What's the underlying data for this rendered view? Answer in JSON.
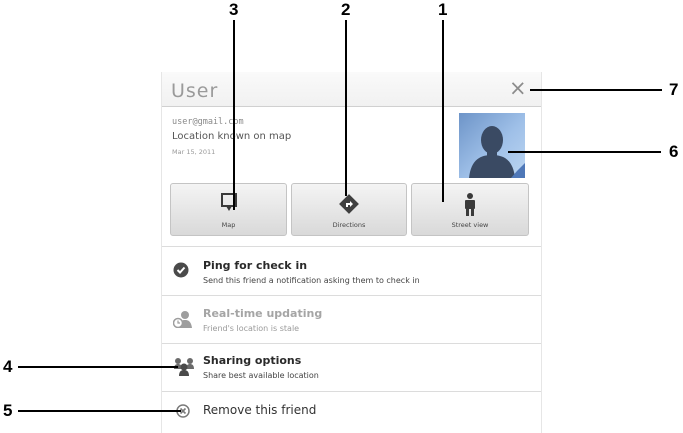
{
  "callouts": [
    "1",
    "2",
    "3",
    "4",
    "5",
    "6",
    "7"
  ],
  "dialog": {
    "title": "User",
    "close_glyph": "×"
  },
  "profile": {
    "email": "user@gmail.com",
    "location_status": "Location known on map",
    "date": "Mar 15, 2011",
    "avatar_icon": "person-silhouette-icon"
  },
  "actions": {
    "map": {
      "label": "Map",
      "icon": "map-marker-icon"
    },
    "directions": {
      "label": "Directions",
      "icon": "directions-icon"
    },
    "street_view": {
      "label": "Street view",
      "icon": "pegman-icon"
    }
  },
  "options": [
    {
      "title": "Ping for check in",
      "subtitle": "Send this friend a notification asking them to check in",
      "icon": "checkmark-circle-icon",
      "enabled": true
    },
    {
      "title": "Real-time updating",
      "subtitle": "Friend's location is stale",
      "icon": "realtime-person-icon",
      "enabled": false
    },
    {
      "title": "Sharing options",
      "subtitle": "Share best available location",
      "icon": "sharing-people-icon",
      "enabled": true
    }
  ],
  "remove": {
    "label": "Remove this friend",
    "icon": "remove-circle-icon"
  },
  "colors": {
    "muted_text": "#9a9a9a",
    "dark_text": "#333333",
    "avatar_blue": "#7aa2d6"
  }
}
